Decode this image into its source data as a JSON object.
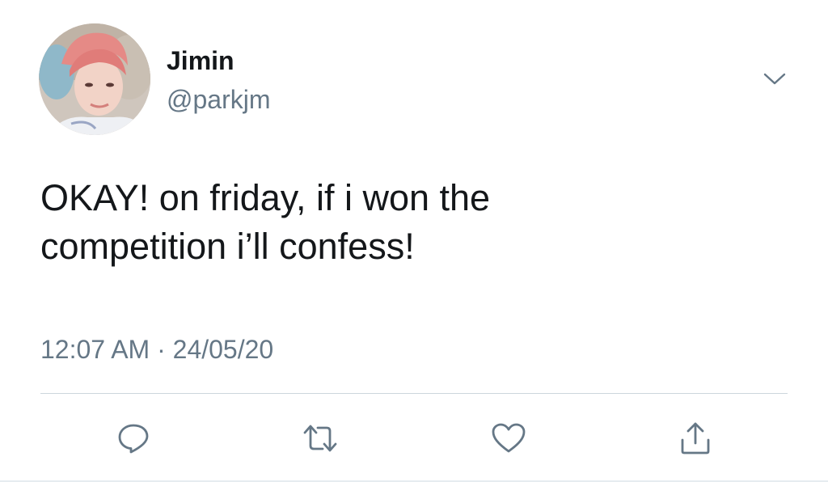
{
  "tweet": {
    "author": {
      "display_name": "Jimin",
      "handle": "@parkjm",
      "avatar_icon": "profile-photo"
    },
    "text_lines": [
      "OKAY! on friday, if i won the",
      "competition i’ll confess!"
    ],
    "meta": {
      "time": "12:07 AM",
      "separator": "·",
      "date": "24/05/20"
    },
    "menu_icon": "chevron-down-icon",
    "actions": [
      {
        "name": "reply",
        "icon": "reply-icon"
      },
      {
        "name": "retweet",
        "icon": "retweet-icon"
      },
      {
        "name": "like",
        "icon": "heart-icon"
      },
      {
        "name": "share",
        "icon": "share-icon"
      }
    ]
  },
  "colors": {
    "primary_text": "#14171a",
    "secondary_text": "#657786",
    "divider": "#ccd6dd",
    "icon": "#657786"
  }
}
